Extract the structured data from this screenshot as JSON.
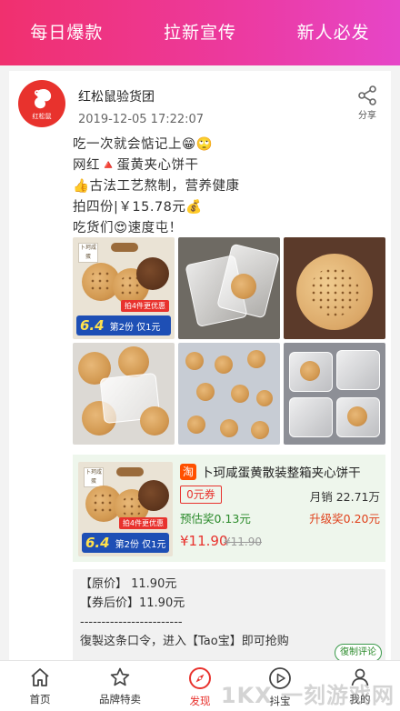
{
  "top_tabs": [
    {
      "label": "每日爆款"
    },
    {
      "label": "拉新宣传"
    },
    {
      "label": "新人必发"
    }
  ],
  "post": {
    "avatar_brand": "红松鼠",
    "shop_name": "红松鼠验货团",
    "datetime": "2019-12-05 17:22:07",
    "share_label": "分享",
    "lines": [
      " 吃一次就会惦记上😁🙄",
      "网红🔺蛋黄夹心饼干",
      "👍古法工艺熬制，营养健康",
      "拍四份|￥15.78元💰",
      "吃货们😍速度屯！"
    ],
    "images": [
      {
        "name": "product-image-package",
        "promo_big": "6.4",
        "promo_text": "第2份 仅1元",
        "promo_tag": "拍4件更优惠",
        "pkg_label": "卜珂咸蛋"
      },
      {
        "name": "product-image-bags"
      },
      {
        "name": "product-image-biscuit-closeup"
      },
      {
        "name": "product-image-bag-hand"
      },
      {
        "name": "product-image-many-bags"
      },
      {
        "name": "product-image-bags-grey"
      }
    ]
  },
  "product": {
    "tao_icon": "淘",
    "title": "卜珂咸蛋黄散装整箱夹心饼干",
    "coupon": "0元券",
    "sold": "月销 22.71万",
    "estimated_reward": "预估奖0.13元",
    "upgrade_reward": "升级奖0.20元",
    "price": "¥11.90",
    "original_price": "¥11.90",
    "promo_big": "6.4",
    "promo_text": "第2份 仅1元",
    "promo_tag": "拍4件更优惠",
    "pkg_label": "卜珂咸蛋"
  },
  "info": {
    "lines": [
      "【原价】 11.90元",
      "【券后价】11.90元",
      "------------------------",
      "復製这条口令，进入【Tao宝】即可抢购"
    ],
    "copy_button": "復制评论"
  },
  "bottom_nav": [
    {
      "label": "首页",
      "icon": "home-icon"
    },
    {
      "label": "品牌特卖",
      "icon": "star-icon"
    },
    {
      "label": "发现",
      "icon": "compass-icon",
      "active": true
    },
    {
      "label": "抖宝",
      "icon": "play-icon"
    },
    {
      "label": "我的",
      "icon": "user-icon"
    }
  ],
  "watermark": "1KX 一刻游戏网",
  "colors": {
    "brand_red": "#e8322d",
    "topbar_start": "#f0306e",
    "topbar_end": "#e646c8",
    "reward_green": "#2a8a2a"
  }
}
